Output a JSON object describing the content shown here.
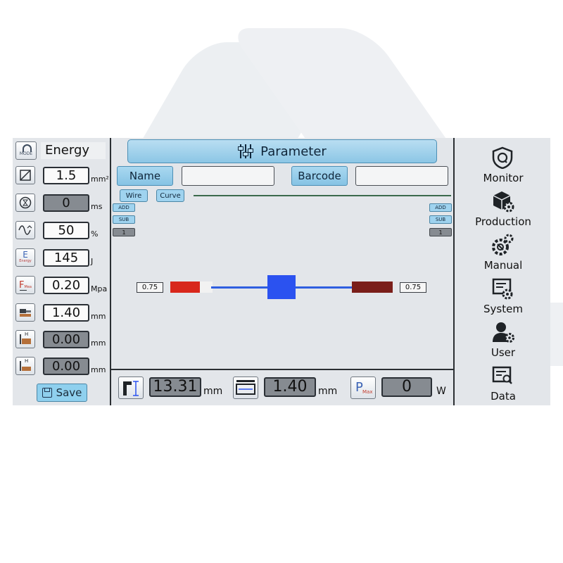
{
  "mode": {
    "value": "Energy",
    "icon": "mode-dial-icon",
    "icon_text": "MODE"
  },
  "params": [
    {
      "icon": "area-icon",
      "value": "1.5",
      "unit": "mm²",
      "style": "white"
    },
    {
      "icon": "time-icon",
      "value": "0",
      "unit": "ms",
      "style": "grey"
    },
    {
      "icon": "amplitude-icon",
      "value": "50",
      "unit": "%",
      "style": "white"
    },
    {
      "icon": "energy-icon",
      "icon_text": "E",
      "icon_sub": "Energy",
      "value": "145",
      "unit": "J",
      "style": "white"
    },
    {
      "icon": "pressure-icon",
      "icon_text": "F",
      "icon_sub": "Mea",
      "value": "0.20",
      "unit": "Mpa",
      "style": "white"
    },
    {
      "icon": "height-icon",
      "value": "1.40",
      "unit": "mm",
      "style": "white"
    },
    {
      "icon": "height-high-icon",
      "icon_text": "H",
      "value": "0.00",
      "unit": "mm",
      "style": "grey"
    },
    {
      "icon": "height-low-icon",
      "icon_text": "H",
      "value": "0.00",
      "unit": "mm",
      "style": "grey"
    }
  ],
  "save": {
    "label": "Save"
  },
  "header": {
    "title": "Parameter"
  },
  "fields": {
    "name_label": "Name",
    "barcode_label": "Barcode",
    "name_value": "",
    "barcode_value": ""
  },
  "tabs": [
    {
      "label": "Wire"
    },
    {
      "label": "Curve"
    }
  ],
  "left_controls": {
    "add": "ADD",
    "sub": "SUB",
    "count": "1"
  },
  "right_controls": {
    "add": "ADD",
    "sub": "SUB",
    "count": "1"
  },
  "wire": {
    "left_value": "0.75",
    "right_value": "0.75",
    "left_color": "#d8271c",
    "node_color": "#2b52f0",
    "right_color": "#7a1e1a"
  },
  "bottom": {
    "weld_height": {
      "value": "13.31",
      "unit": "mm"
    },
    "compressed_height": {
      "value": "1.40",
      "unit": "mm"
    },
    "max_power": {
      "icon_text": "P",
      "icon_sub": "Max",
      "value": "0",
      "unit": "W"
    }
  },
  "nav": [
    {
      "label": "Monitor",
      "icon": "monitor-shield-icon"
    },
    {
      "label": "Production",
      "icon": "production-box-gear-icon"
    },
    {
      "label": "Manual",
      "icon": "manual-gears-icon"
    },
    {
      "label": "System",
      "icon": "system-settings-icon"
    },
    {
      "label": "User",
      "icon": "user-gear-icon"
    },
    {
      "label": "Data",
      "icon": "data-search-icon"
    }
  ],
  "colors": {
    "accent": "#8cc6e5",
    "panel": "#e3e6ea",
    "grey_box": "#868b91"
  }
}
